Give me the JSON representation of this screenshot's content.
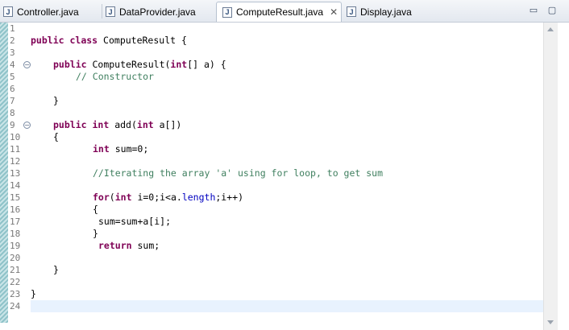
{
  "tabs": [
    {
      "label": "Controller.java",
      "icon": "java-file-icon"
    },
    {
      "label": "DataProvider.java",
      "icon": "java-file-icon"
    },
    {
      "label": "ComputeResult.java",
      "icon": "java-file-icon",
      "active": true
    },
    {
      "label": "Display.java",
      "icon": "java-file-icon"
    }
  ],
  "tab_close_glyph": "✕",
  "window_controls": {
    "minimize": "▭",
    "maximize": "▢"
  },
  "line_numbers": [
    "1",
    "2",
    "3",
    "4",
    "5",
    "6",
    "7",
    "8",
    "9",
    "10",
    "11",
    "12",
    "13",
    "14",
    "15",
    "16",
    "17",
    "18",
    "19",
    "20",
    "21",
    "22",
    "23",
    "24"
  ],
  "code": {
    "l2": [
      "public",
      "class",
      "ComputeResult {"
    ],
    "l4": [
      "public",
      "ComputeResult(",
      "int",
      "[] a) {"
    ],
    "l5": "// Constructor",
    "l7": "}",
    "l9": [
      "public",
      "int",
      "add(",
      "int",
      "a[])"
    ],
    "l10": "{",
    "l11": [
      "int",
      "sum=0;"
    ],
    "l13": "//Iterating the array 'a' using for loop, to get sum",
    "l15": [
      "for",
      "(",
      "int",
      "i=0;i<a.",
      "length",
      ";i++)"
    ],
    "l16": "{",
    "l17": "sum=sum+a[i];",
    "l18": "}",
    "l19": [
      "return",
      "sum;"
    ],
    "l21": "}",
    "l23": "}"
  },
  "colors": {
    "keyword": "#7f0055",
    "comment": "#3f7f5f",
    "field": "#0000c0",
    "current_line": "#e8f2fe"
  }
}
